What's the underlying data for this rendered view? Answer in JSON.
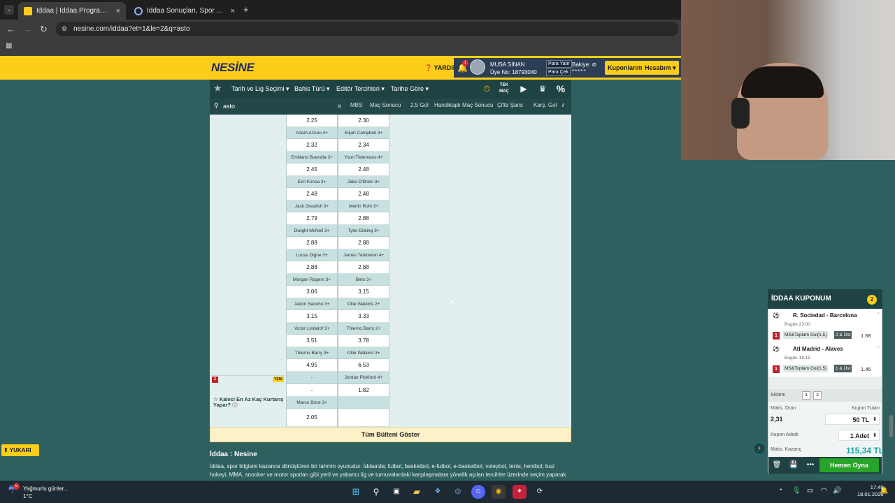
{
  "browser": {
    "tabs": [
      {
        "title": "İddaa | İddaa Programı | Canlı İddaa",
        "active": true
      },
      {
        "title": "İddaa Sonuçları, Spor Toto Süper Lig",
        "active": false
      }
    ],
    "new_tab": "+",
    "url": "nesine.com/iddaa?et=1&le=2&q=asto"
  },
  "header": {
    "logo": "NESİNE",
    "help": "YARDIM",
    "notif_count": "1",
    "user_name": "MUSA SİNAN",
    "user_no": "Üye No: 18793040",
    "para_yatir": "Para Yatır",
    "para_cek": "Para Çek",
    "bakiye_label": "Bakiye:",
    "bakiye_hidden": "*****",
    "kuponlarim": "Kuponlarım",
    "hesabim": "Hesabım"
  },
  "nav": {
    "items": [
      "Tarih ve Lig Seçimi",
      "Bahis Türü",
      "Editör Tercihleri",
      "Tarihe Göre"
    ],
    "tek_mac": "TEK MAÇ",
    "percent": "%"
  },
  "search": {
    "value": "asto",
    "close": "×"
  },
  "columns": [
    "MBS",
    "Maç Sonucu",
    "2,5 Gol",
    "Handikaplı Maç Sonucu",
    "Çifte Şans",
    "Karş. Gol",
    "i"
  ],
  "players": {
    "top_values": [
      "2.25",
      "2.30"
    ],
    "rows": [
      {
        "left_name": "Adam Aznou 4+",
        "left_val": "2.32",
        "right_name": "Elijah Campbell 3+",
        "right_val": "2.34"
      },
      {
        "left_name": "Emiliano Buendia 3+",
        "left_val": "2.45",
        "right_name": "Youri Tielemans 4+",
        "right_val": "2.48"
      },
      {
        "left_name": "Ezri Konsa 3+",
        "left_val": "2.48",
        "right_name": "Jake O'Brien 3+",
        "right_val": "2.48"
      },
      {
        "left_name": "Jack Grealish 3+",
        "left_val": "2.79",
        "right_name": "Merlin Rohl 3+",
        "right_val": "2.88"
      },
      {
        "left_name": "Dwight McNeil 3+",
        "left_val": "2.88",
        "right_name": "Tyler Dibling 3+",
        "right_val": "2.88"
      },
      {
        "left_name": "Lucas Digne 3+",
        "left_val": "2.88",
        "right_name": "James Tarkowski 4+",
        "right_val": "2.88"
      },
      {
        "left_name": "Morgan Rogers 3+",
        "left_val": "3.06",
        "right_name": "Beto 3+",
        "right_val": "3.15"
      },
      {
        "left_name": "Jadon Sancho 3+",
        "left_val": "3.15",
        "right_name": "Ollie Watkins 2+",
        "right_val": "3.33"
      },
      {
        "left_name": "Victor Lindelof 3+",
        "left_val": "3.51",
        "right_name": "Thierno Barry 2+",
        "right_val": "3.78"
      },
      {
        "left_name": "Thierno Barry 3+",
        "left_val": "4.95",
        "right_name": "Ollie Watkins 3+",
        "right_val": "6.53"
      }
    ]
  },
  "kaleci": {
    "mbs": "1",
    "badge": "YENİ",
    "question": "Kaleci En Az Kaç Kurtarış Yapar?",
    "left_name1": "-",
    "right_name1": "Jordan Pickford 4+",
    "left_val1": "-",
    "right_val1": "1.82",
    "left_name2": "Marco Bizot 3+",
    "right_name2": "",
    "left_val2": "2.05",
    "right_val2": ""
  },
  "bulten_button": "Tüm Bülteni Göster",
  "about": {
    "heading": "İddaa : Nesine",
    "text": "İddaa, spor bilgisini kazanca dönüştüren bir tahmin oyunudur. İddaa'da; futbol, basketbol, e-futbol, e-basketbol, voleybol, tenis, hentbol, buz hokeyi, MMA, snooker ve motor sporları gibi yerli ve yabancı lig ve turnuvalardaki karşılaşmalara yönelik açılan tercihler üzerinde seçim yaparak İddaa"
  },
  "yukari": "YUKARI",
  "kupon": {
    "title": "İDDAA KUPONUM",
    "count": "2",
    "matches": [
      {
        "mbs": "1",
        "name": "R. Sociedad - Barcelona",
        "time": "Bugün 23:00",
        "bet": "MS&Toplam Gol(1,5)",
        "pick": "2 & Üst",
        "odd": "1.58"
      },
      {
        "mbs": "1",
        "name": "Atl Madrid - Alaves",
        "time": "Bugün 18:15",
        "bet": "MS&Toplam Gol(1,5)",
        "pick": "1 & Üst",
        "odd": "1.46"
      }
    ],
    "sistem_label": "Sistem",
    "sistem_opts": [
      "1",
      "2"
    ],
    "maks_oran_label": "Maks. Oran",
    "maks_oran": "2,31",
    "kupon_tutari_label": "Kupon Tutarı",
    "kupon_tutari": "50 TL",
    "kupon_adedi_label": "Kupon Adedi",
    "kupon_adedi": "1 Adet",
    "maks_kazanc_label": "Maks. Kazanç",
    "maks_kazanc": "115,34 TL",
    "play": "Hemen Oyna"
  },
  "taskbar": {
    "weather_title": "Yağmurlu günler...",
    "weather_temp": "1°C",
    "time": "17:49",
    "date": "18.01.2026"
  },
  "colors": {
    "yellow": "#fdcd19",
    "dark_teal": "#1f4343",
    "bg": "#2f6060",
    "green": "#27a52b"
  }
}
